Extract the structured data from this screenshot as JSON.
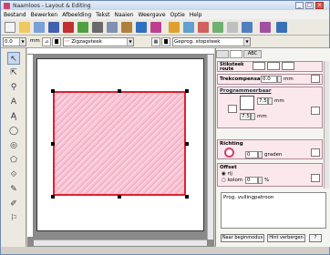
{
  "window": {
    "title": "Naamloos - Layout & Editing",
    "controls": [
      "_",
      "□",
      "×"
    ]
  },
  "menu": [
    "Bestand",
    "Bewerken",
    "Afbeelding",
    "Tekst",
    "Naaien",
    "Weergave",
    "Optie",
    "Help"
  ],
  "toolbar2": {
    "size_value": "0.0",
    "unit_label": "mm",
    "line_style_value": "Zigzagsteek",
    "fill_style_value": "Geprog. stopsteek"
  },
  "panel": {
    "tabs": [
      "",
      "",
      "ABC"
    ],
    "stitch_mode_label": "Stiksteek\nroute",
    "compensation_label": "Trekcompensatie",
    "compensation_value": "0.0",
    "compensation_unit": "mm",
    "programmable_label": "Programmeerbaar",
    "prog_width_value": "7.5",
    "prog_height_value": "7.5",
    "prog_unit": "mm",
    "direction_label": "Richting",
    "direction_value": "0",
    "direction_unit": "graden",
    "offset_label": "Offset",
    "offset_option_1": "rij",
    "offset_option_2": "kolom",
    "offset_value": "0",
    "offset_unit": "%",
    "pattern_text": "Prog. vullingpatroon",
    "btn_start": "Naar beginmodus",
    "btn_hide": "Hint verbergen"
  },
  "colors": {
    "accent": "#d04070",
    "stitch_border": "#e02030",
    "stitch_fill": "#f7c2d3"
  }
}
